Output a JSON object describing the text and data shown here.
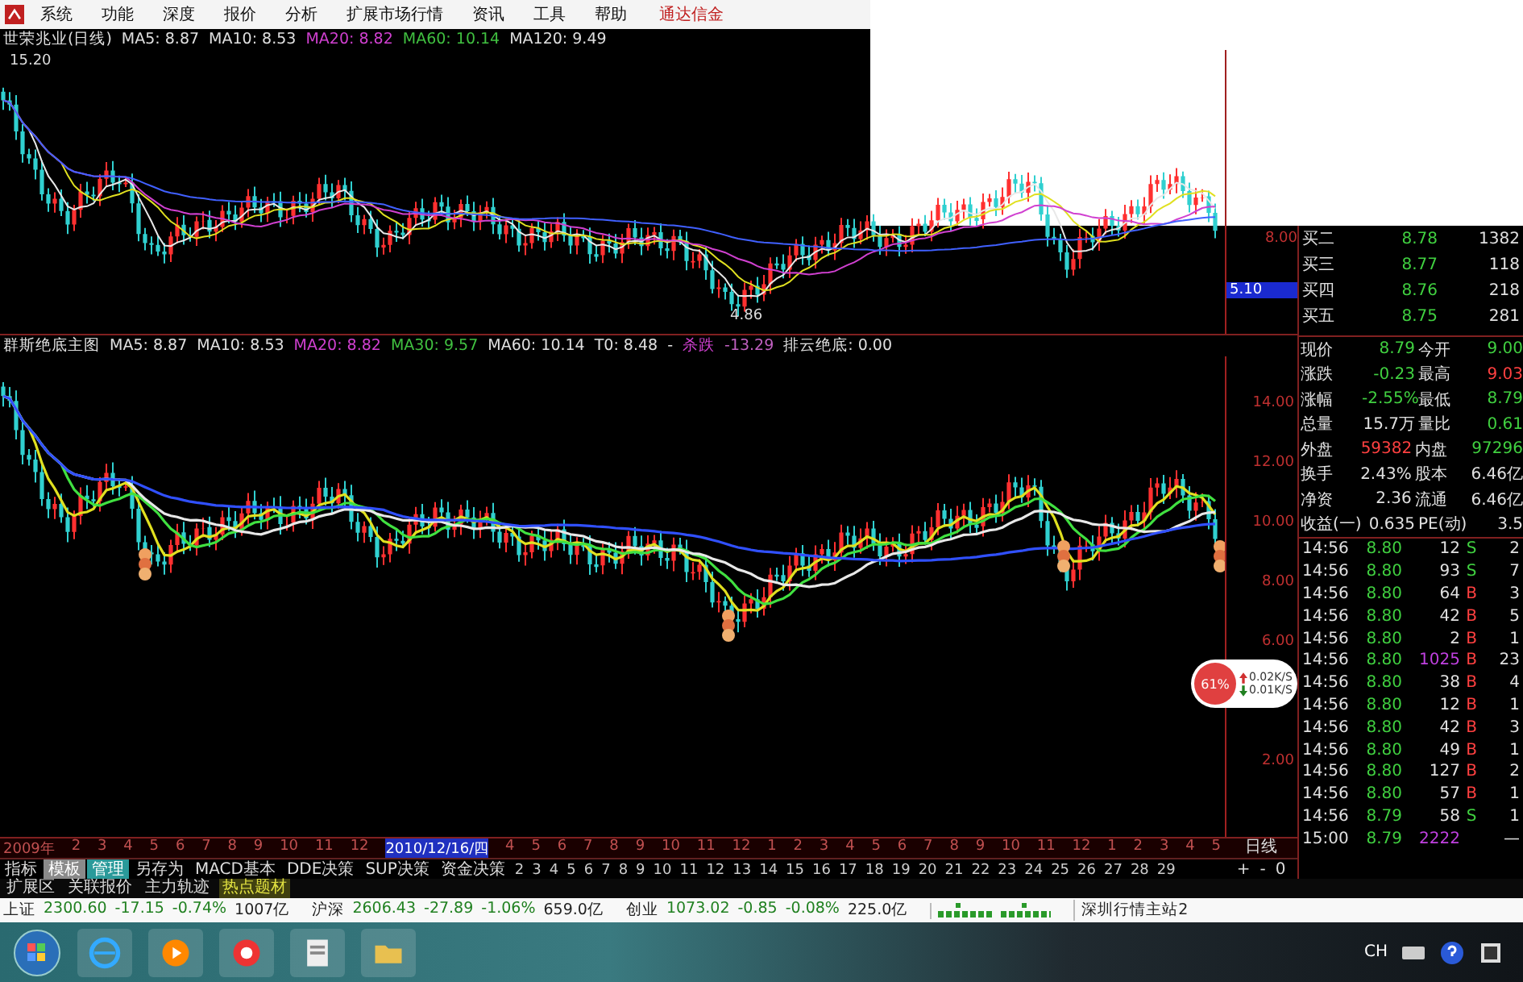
{
  "menu": {
    "items": [
      "系统",
      "功能",
      "深度",
      "报价",
      "分析",
      "扩展市场行情",
      "资讯",
      "工具",
      "帮助"
    ],
    "brand": "通达信金"
  },
  "top_chart": {
    "legend": [
      {
        "text": "世荣兆业(日线)",
        "color": "#e0e0e0"
      },
      {
        "text": "MA5: 8.87",
        "color": "#e0e0e0"
      },
      {
        "text": "MA10: 8.53",
        "color": "#e0e0e0"
      },
      {
        "text": "MA20: 8.82",
        "color": "#d040d0"
      },
      {
        "text": "MA60: 10.14",
        "color": "#40c040"
      },
      {
        "text": "MA120: 9.49",
        "color": "#e0e0e0"
      }
    ],
    "high_label": "15.20",
    "low_label": "4.86",
    "axis_labels": [
      "8.00"
    ],
    "cursor_price": "5.10"
  },
  "main_chart": {
    "legend": [
      {
        "text": "群斯绝底主图",
        "color": "#e0e0e0"
      },
      {
        "text": "MA5: 8.87",
        "color": "#e0e0e0"
      },
      {
        "text": "MA10: 8.53",
        "color": "#e0e0e0"
      },
      {
        "text": "MA20: 8.82",
        "color": "#d040d0"
      },
      {
        "text": "MA30: 9.57",
        "color": "#40c040"
      },
      {
        "text": "MA60: 10.14",
        "color": "#e0e0e0"
      },
      {
        "text": "T0: 8.48",
        "color": "#e0e0e0"
      },
      {
        "text": "-",
        "color": "#e0e0e0"
      },
      {
        "text": "杀跌",
        "color": "#d040d0"
      },
      {
        "text": "-13.29",
        "color": "#c060c0"
      },
      {
        "text": "排云绝底: 0.00",
        "color": "#e0e0e0"
      }
    ],
    "axis_labels": [
      "14.00",
      "12.00",
      "10.00",
      "8.00",
      "6.00",
      "2.00"
    ],
    "flow_badge": {
      "percent": "61%",
      "up": "0.02K/S",
      "down": "0.01K/S"
    }
  },
  "date_axis": {
    "labels": [
      {
        "text": "2009年",
        "kind": "label"
      },
      {
        "text": "2",
        "kind": "label"
      },
      {
        "text": "3",
        "kind": "label"
      },
      {
        "text": "4",
        "kind": "label"
      },
      {
        "text": "5",
        "kind": "label"
      },
      {
        "text": "6",
        "kind": "label"
      },
      {
        "text": "7",
        "kind": "label"
      },
      {
        "text": "8",
        "kind": "label"
      },
      {
        "text": "9",
        "kind": "label"
      },
      {
        "text": "10",
        "kind": "label"
      },
      {
        "text": "11",
        "kind": "label"
      },
      {
        "text": "12",
        "kind": "label"
      },
      {
        "text": "2010/12/16/四",
        "kind": "cursor"
      },
      {
        "text": "4",
        "kind": "label"
      },
      {
        "text": "5",
        "kind": "label"
      },
      {
        "text": "6",
        "kind": "label"
      },
      {
        "text": "7",
        "kind": "label"
      },
      {
        "text": "8",
        "kind": "label"
      },
      {
        "text": "9",
        "kind": "label"
      },
      {
        "text": "10",
        "kind": "label"
      },
      {
        "text": "11",
        "kind": "label"
      },
      {
        "text": "12",
        "kind": "label"
      },
      {
        "text": "1",
        "kind": "label"
      },
      {
        "text": "2",
        "kind": "label"
      },
      {
        "text": "3",
        "kind": "label"
      },
      {
        "text": "4",
        "kind": "label"
      },
      {
        "text": "5",
        "kind": "label"
      },
      {
        "text": "6",
        "kind": "label"
      },
      {
        "text": "7",
        "kind": "label"
      },
      {
        "text": "8",
        "kind": "label"
      },
      {
        "text": "9",
        "kind": "label"
      },
      {
        "text": "10",
        "kind": "label"
      },
      {
        "text": "11",
        "kind": "label"
      },
      {
        "text": "12",
        "kind": "label"
      },
      {
        "text": "1",
        "kind": "label"
      },
      {
        "text": "2",
        "kind": "label"
      },
      {
        "text": "3",
        "kind": "label"
      },
      {
        "text": "4",
        "kind": "label"
      },
      {
        "text": "5",
        "kind": "label"
      }
    ],
    "period": "日线"
  },
  "tabs": [
    {
      "label": "指标",
      "selected": false,
      "pressed": false
    },
    {
      "label": "模板",
      "selected": false,
      "pressed": true
    },
    {
      "label": "管理",
      "selected": true,
      "pressed": false
    },
    {
      "label": "另存为",
      "selected": false,
      "pressed": false
    },
    {
      "label": "MACD基本",
      "selected": false,
      "pressed": false
    },
    {
      "label": "DDE决策",
      "selected": false,
      "pressed": false
    },
    {
      "label": "SUP决策",
      "selected": false,
      "pressed": false
    },
    {
      "label": "资金决策",
      "selected": false,
      "pressed": false
    }
  ],
  "page_numbers": [
    "2",
    "3",
    "4",
    "5",
    "6",
    "7",
    "8",
    "9",
    "10",
    "11",
    "12",
    "13",
    "14",
    "15",
    "16",
    "17",
    "18",
    "19",
    "20",
    "21",
    "22",
    "23",
    "24",
    "25",
    "26",
    "27",
    "28",
    "29"
  ],
  "zoom_buttons": [
    "+",
    "-",
    "0"
  ],
  "sub_tabs": [
    {
      "label": "扩展区",
      "selected": false
    },
    {
      "label": "关联报价",
      "selected": false
    },
    {
      "label": "主力轨迹",
      "selected": false
    },
    {
      "label": "热点题材",
      "selected": true
    }
  ],
  "order_book": [
    {
      "label": "买二",
      "price": "8.78",
      "volume": "1382"
    },
    {
      "label": "买三",
      "price": "8.77",
      "volume": "118"
    },
    {
      "label": "买四",
      "price": "8.76",
      "volume": "218"
    },
    {
      "label": "买五",
      "price": "8.75",
      "volume": "281"
    }
  ],
  "quote": [
    {
      "cells": [
        {
          "label": "现价",
          "value": "8.79",
          "color": "#40d040"
        },
        {
          "label": "今开",
          "value": "9.00",
          "color": "#40d040"
        }
      ]
    },
    {
      "cells": [
        {
          "label": "涨跌",
          "value": "-0.23",
          "color": "#40d040"
        },
        {
          "label": "最高",
          "value": "9.03",
          "color": "#ff4040"
        }
      ]
    },
    {
      "cells": [
        {
          "label": "涨幅",
          "value": "-2.55%",
          "color": "#40d040"
        },
        {
          "label": "最低",
          "value": "8.79",
          "color": "#40d040"
        }
      ]
    },
    {
      "cells": [
        {
          "label": "总量",
          "value": "15.7万",
          "color": "#e0e0e0"
        },
        {
          "label": "量比",
          "value": "0.61",
          "color": "#40d040"
        }
      ]
    },
    {
      "cells": [
        {
          "label": "外盘",
          "value": "59382",
          "color": "#ff4040"
        },
        {
          "label": "内盘",
          "value": "97296",
          "color": "#40d040"
        }
      ]
    },
    {
      "cells": [
        {
          "label": "换手",
          "value": "2.43%",
          "color": "#e0e0e0"
        },
        {
          "label": "股本",
          "value": "6.46亿",
          "color": "#e0e0e0"
        }
      ]
    },
    {
      "cells": [
        {
          "label": "净资",
          "value": "2.36",
          "color": "#e0e0e0"
        },
        {
          "label": "流通",
          "value": "6.46亿",
          "color": "#e0e0e0"
        }
      ]
    },
    {
      "cells": [
        {
          "label": "收益(一)",
          "value": "0.635",
          "color": "#e0e0e0"
        },
        {
          "label": "PE(动)",
          "value": "3.5",
          "color": "#e0e0e0"
        }
      ]
    }
  ],
  "ticks": [
    {
      "time": "14:56",
      "price": "8.80",
      "volume": "12",
      "large": false,
      "side": "S",
      "count": "2"
    },
    {
      "time": "14:56",
      "price": "8.80",
      "volume": "93",
      "large": false,
      "side": "S",
      "count": "7"
    },
    {
      "time": "14:56",
      "price": "8.80",
      "volume": "64",
      "large": false,
      "side": "B",
      "count": "3"
    },
    {
      "time": "14:56",
      "price": "8.80",
      "volume": "42",
      "large": false,
      "side": "B",
      "count": "5"
    },
    {
      "time": "14:56",
      "price": "8.80",
      "volume": "2",
      "large": false,
      "side": "B",
      "count": "1"
    },
    {
      "time": "14:56",
      "price": "8.80",
      "volume": "1025",
      "large": true,
      "side": "B",
      "count": "23"
    },
    {
      "time": "14:56",
      "price": "8.80",
      "volume": "38",
      "large": false,
      "side": "B",
      "count": "4"
    },
    {
      "time": "14:56",
      "price": "8.80",
      "volume": "12",
      "large": false,
      "side": "B",
      "count": "1"
    },
    {
      "time": "14:56",
      "price": "8.80",
      "volume": "42",
      "large": false,
      "side": "B",
      "count": "3"
    },
    {
      "time": "14:56",
      "price": "8.80",
      "volume": "49",
      "large": false,
      "side": "B",
      "count": "1"
    },
    {
      "time": "14:56",
      "price": "8.80",
      "volume": "127",
      "large": false,
      "side": "B",
      "count": "2"
    },
    {
      "time": "14:56",
      "price": "8.80",
      "volume": "57",
      "large": false,
      "side": "B",
      "count": "1"
    },
    {
      "time": "14:56",
      "price": "8.79",
      "volume": "58",
      "large": false,
      "side": "S",
      "count": "1"
    },
    {
      "time": "15:00",
      "price": "8.79",
      "volume": "2222",
      "large": true,
      "count": "—"
    }
  ],
  "status_bar": {
    "indices": [
      {
        "name": "上证",
        "value": "2300.60",
        "change": "-17.15",
        "percent": "-0.74%",
        "amount": "1007亿"
      },
      {
        "name": "沪深",
        "value": "2606.43",
        "change": "-27.89",
        "percent": "-1.06%",
        "amount": "659.0亿"
      },
      {
        "name": "创业",
        "value": "1073.02",
        "change": "-0.85",
        "percent": "-0.08%",
        "amount": "225.0亿"
      }
    ],
    "server": "深圳行情主站2"
  },
  "taskbar": {
    "language": "CH"
  }
}
